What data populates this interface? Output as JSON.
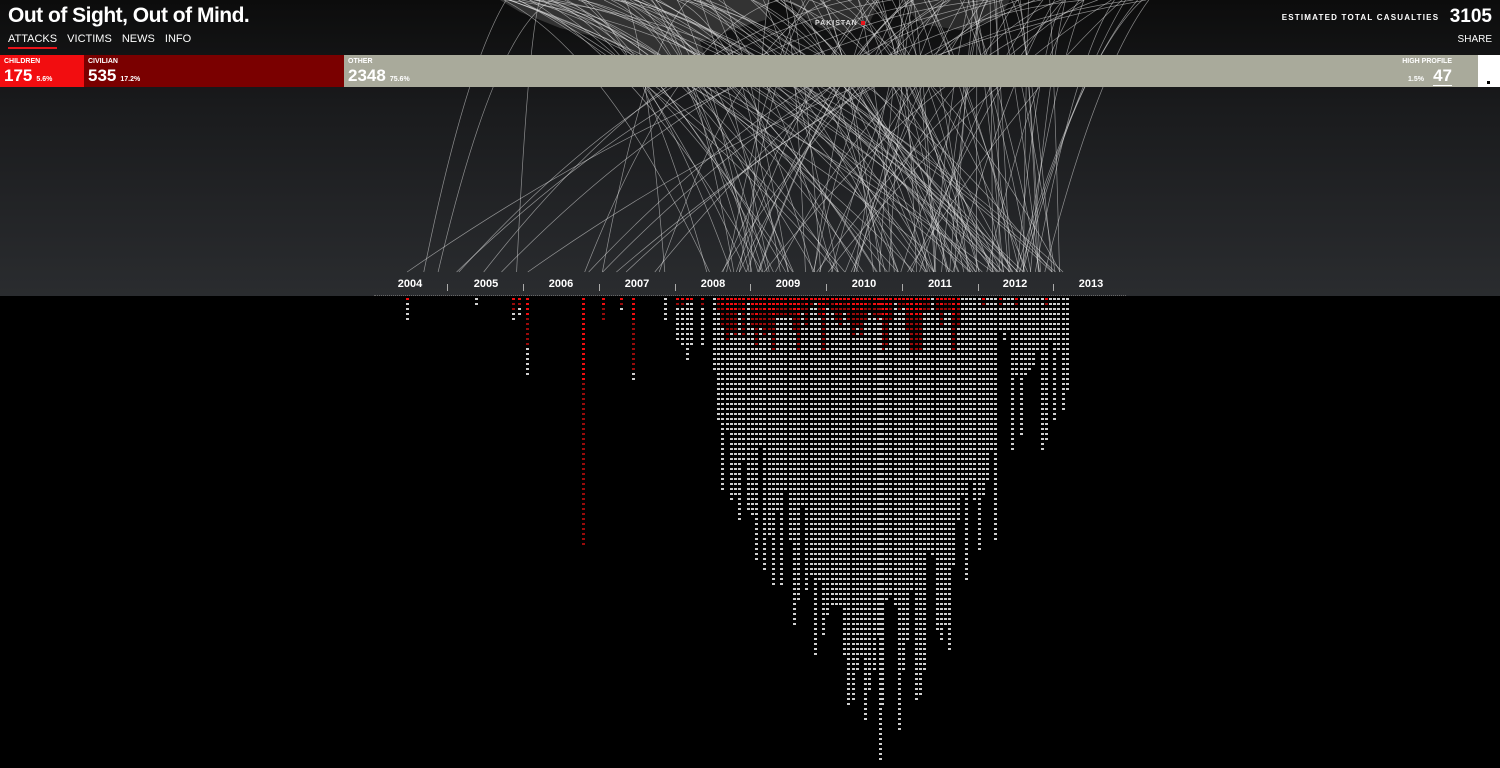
{
  "header": {
    "title": "Out of Sight, Out of Mind.",
    "nav": [
      "ATTACKS",
      "VICTIMS",
      "NEWS",
      "INFO"
    ],
    "active_nav": "ATTACKS",
    "totals_label": "ESTIMATED TOTAL CASUALTIES",
    "totals_value": "3105",
    "share_label": "SHARE"
  },
  "map": {
    "location_label": "PAKISTAN"
  },
  "breakdown": {
    "children": {
      "label": "CHILDREN",
      "value": "175",
      "pct": "5.6%"
    },
    "civilian": {
      "label": "CIVILIAN",
      "value": "535",
      "pct": "17.2%"
    },
    "other": {
      "label": "OTHER",
      "value": "2348",
      "pct": "75.6%"
    },
    "high_profile": {
      "label": "HIGH PROFILE",
      "value": "47",
      "pct": "1.5%"
    }
  },
  "timeline": {
    "years": [
      "2004",
      "2005",
      "2006",
      "2007",
      "2008",
      "2009",
      "2010",
      "2011",
      "2012",
      "2013"
    ]
  },
  "colors": {
    "children": "#f20d10",
    "civilian": "#7a0000",
    "other": "#a9aa9b",
    "high_profile": "#ffffff",
    "accent": "#e8141b"
  }
}
